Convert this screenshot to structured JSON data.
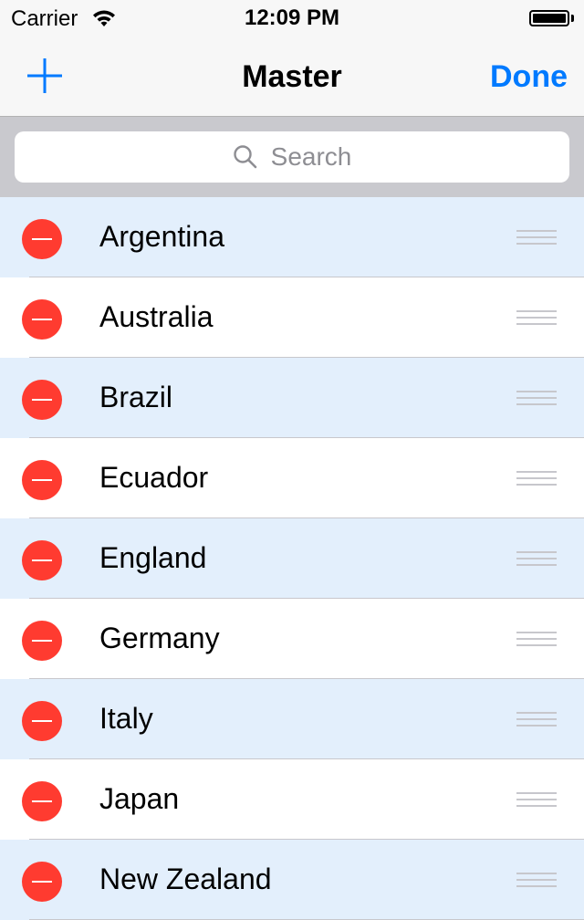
{
  "status_bar": {
    "carrier": "Carrier",
    "time": "12:09 PM",
    "wifi_icon": "wifi-icon",
    "battery_icon": "battery-full-icon"
  },
  "nav_bar": {
    "title": "Master",
    "done_label": "Done",
    "add_icon": "plus-icon",
    "accent_color": "#007aff"
  },
  "search": {
    "placeholder": "Search",
    "icon": "search-icon"
  },
  "list": {
    "items": [
      {
        "label": "Argentina"
      },
      {
        "label": "Australia"
      },
      {
        "label": "Brazil"
      },
      {
        "label": "Ecuador"
      },
      {
        "label": "England"
      },
      {
        "label": "Germany"
      },
      {
        "label": "Italy"
      },
      {
        "label": "Japan"
      },
      {
        "label": "New Zealand"
      }
    ],
    "delete_icon": "minus-circle-icon",
    "reorder_icon": "reorder-handle-icon",
    "delete_color": "#ff3b30",
    "alt_row_color": "#e3effc"
  }
}
